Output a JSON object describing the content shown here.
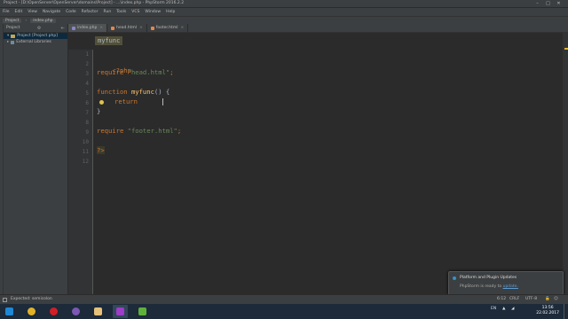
{
  "window": {
    "title": "Project - [D:\\OpenServer\\OpenServer\\domains\\Project] - ...\\index.php - PhpStorm 2016.2.2",
    "controls": [
      "minimize",
      "maximize",
      "close"
    ]
  },
  "menu": [
    "File",
    "Edit",
    "View",
    "Navigate",
    "Code",
    "Refactor",
    "Run",
    "Tools",
    "VCS",
    "Window",
    "Help"
  ],
  "navbar": {
    "crumbs": [
      "Project",
      "index.php"
    ]
  },
  "project_panel": {
    "header": "Project",
    "tree": [
      {
        "label": "Project [Project php]",
        "icon": "folder-icon"
      },
      {
        "label": "External Libraries",
        "icon": "library-icon"
      }
    ]
  },
  "editor": {
    "tabs": [
      {
        "label": "index.php",
        "active": true,
        "icon": "php-file-icon"
      },
      {
        "label": "head.html",
        "active": false,
        "icon": "html-file-icon"
      },
      {
        "label": "footer.html",
        "active": false,
        "icon": "html-file-icon"
      }
    ],
    "function_crumb": "myfunc",
    "line_numbers": [
      "1",
      "2",
      "3",
      "4",
      "5",
      "6",
      "7",
      "8",
      "9",
      "10",
      "11",
      "12"
    ],
    "code": {
      "l2_open": "<?php",
      "l3_kw": "require",
      "l3_str": "\"head.html\"",
      "l3_end": ";",
      "l5_kw": "function",
      "l5_name": "myfunc",
      "l5_rest": "() {",
      "l6_kw": "return",
      "l7_close": "}",
      "l9_kw": "require",
      "l9_str": "\"footer.html\"",
      "l9_end": ";",
      "l11_close": "?>"
    }
  },
  "notification": {
    "title": "Platform and Plugin Updates",
    "text_prefix": "PhpStorm is ready to",
    "link": "update."
  },
  "statusbar": {
    "message": "Expected: semicolon",
    "position": "6:12",
    "line_sep": "CRLF",
    "encoding": "UTF-8"
  },
  "taskbar": {
    "apps": [
      {
        "icon": "windows-start-icon",
        "color": "#1f88d6"
      },
      {
        "icon": "chrome-icon",
        "color": "#e0b228"
      },
      {
        "icon": "opera-icon",
        "color": "#d11f25"
      },
      {
        "icon": "viber-icon",
        "color": "#7b58b3"
      },
      {
        "icon": "explorer-icon",
        "color": "#e5c17a"
      },
      {
        "icon": "media-icon",
        "color": "#2c8ad0"
      },
      {
        "icon": "phpstorm-icon",
        "color": "#9e3dc7"
      },
      {
        "icon": "openserver-icon",
        "color": "#444444"
      },
      {
        "icon": "camtasia-icon",
        "color": "#5fb03a"
      }
    ],
    "lang": "EN",
    "time": "13:56",
    "date": "22.02.2017"
  }
}
